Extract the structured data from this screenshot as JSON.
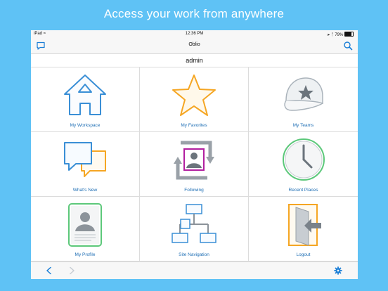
{
  "headline": "Access your work from anywhere",
  "status_bar": {
    "device": "iPad",
    "time": "12:36 PM",
    "battery": "79%"
  },
  "nav": {
    "title": "Oblio"
  },
  "user": {
    "name": "admin"
  },
  "tiles": [
    {
      "label": "My Workspace",
      "icon": "house-icon"
    },
    {
      "label": "My Favorites",
      "icon": "star-icon"
    },
    {
      "label": "My Teams",
      "icon": "cap-icon"
    },
    {
      "label": "What's New",
      "icon": "speech-bubbles-icon"
    },
    {
      "label": "Following",
      "icon": "follow-cycle-icon"
    },
    {
      "label": "Recent Places",
      "icon": "clock-icon"
    },
    {
      "label": "My Profile",
      "icon": "profile-card-icon"
    },
    {
      "label": "Site Navigation",
      "icon": "sitemap-icon"
    },
    {
      "label": "Logout",
      "icon": "logout-door-icon"
    }
  ],
  "colors": {
    "background": "#5fc2f5",
    "accent": "#1a7ed6",
    "orange": "#f5a623",
    "blue_outline": "#3a8fd6"
  }
}
